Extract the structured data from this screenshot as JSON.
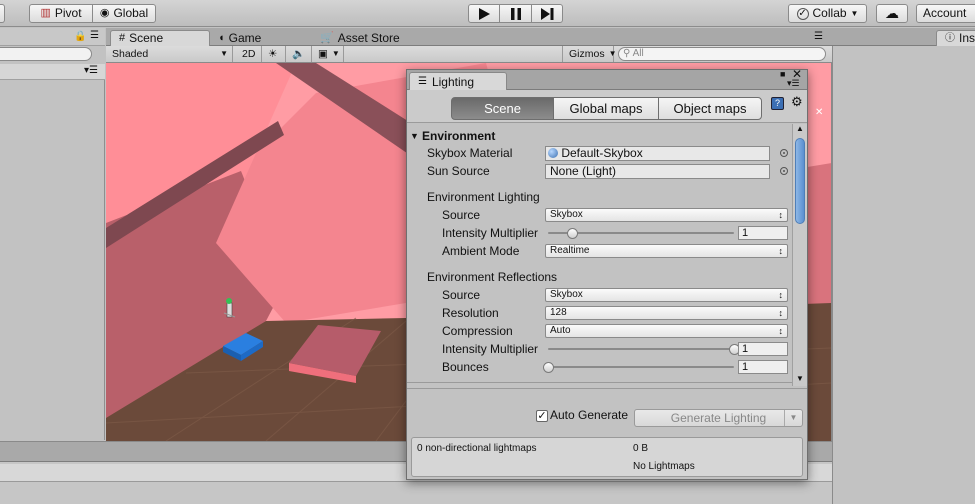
{
  "toolbar": {
    "pivot_label": "Pivot",
    "global_label": "Global",
    "collab_label": "Collab",
    "account_label": "Account"
  },
  "scene_tabs": [
    {
      "label": "Scene"
    },
    {
      "label": "Game"
    },
    {
      "label": "Asset Store"
    }
  ],
  "scene_controls": {
    "shading_mode": "Shaded",
    "mode_2d": "2D",
    "gizmos_label": "Gizmos",
    "search_placeholder": "All"
  },
  "inspector": {
    "tab_label": "Ins"
  },
  "lighting": {
    "window_title": "Lighting",
    "modes": [
      "Scene",
      "Global maps",
      "Object maps"
    ],
    "active_mode": "Scene",
    "section_title": "Environment",
    "skybox_material_label": "Skybox Material",
    "skybox_material_value": "Default-Skybox",
    "sun_source_label": "Sun Source",
    "sun_source_value": "None (Light)",
    "env_lighting_header": "Environment Lighting",
    "env_lighting": {
      "source_label": "Source",
      "source_value": "Skybox",
      "intensity_label": "Intensity Multiplier",
      "intensity_value": "1",
      "intensity_fraction": 0.13,
      "ambient_mode_label": "Ambient Mode",
      "ambient_mode_value": "Realtime"
    },
    "env_reflections_header": "Environment Reflections",
    "env_reflections": {
      "source_label": "Source",
      "source_value": "Skybox",
      "resolution_label": "Resolution",
      "resolution_value": "128",
      "compression_label": "Compression",
      "compression_value": "Auto",
      "intensity_label": "Intensity Multiplier",
      "intensity_value": "1",
      "intensity_fraction": 1.0,
      "bounces_label": "Bounces",
      "bounces_value": "1",
      "bounces_fraction": 0.0
    },
    "auto_generate_label": "Auto Generate",
    "auto_generate_checked": true,
    "generate_button_label": "Generate Lighting",
    "lightmaps_count": "0 non-directional lightmaps",
    "lightmaps_size": "0 B",
    "no_lightmaps": "No Lightmaps"
  }
}
